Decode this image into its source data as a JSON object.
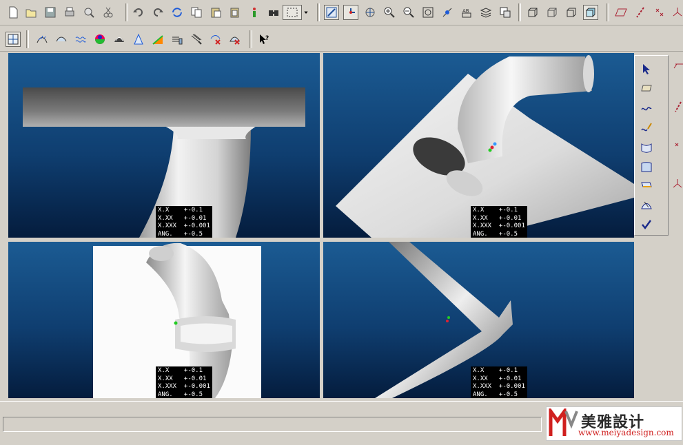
{
  "tolerance_block": {
    "line1": "X.X    +-0.1",
    "line2": "X.XX   +-0.01",
    "line3": "X.XXX  +-0.001",
    "line4": "ANG.   +-0.5"
  },
  "logo": {
    "name": "美雅設计",
    "url": "www.meiyadesign.com"
  },
  "icons": [
    "new-file-icon",
    "open-file-icon",
    "save-icon",
    "print-icon",
    "print-preview-icon",
    "cut-icon",
    "undo-icon",
    "redo-icon",
    "regenerate-icon",
    "copy-icon",
    "paste-icon",
    "info-icon",
    "find-icon",
    "select-box-icon",
    "repaint-icon",
    "spin-center-icon",
    "orient-icon",
    "zoom-in-icon",
    "zoom-out-icon",
    "refit-icon",
    "datum-icon",
    "annotation-icon",
    "layers-icon",
    "model-tree-icon",
    "wireframe-icon",
    "hidden-line-icon",
    "no-hidden-icon",
    "shading-icon",
    "datum-plane-icon",
    "datum-axis-icon",
    "datum-point-icon",
    "coordinate-system-icon"
  ],
  "accent_color": "#0a2f66"
}
